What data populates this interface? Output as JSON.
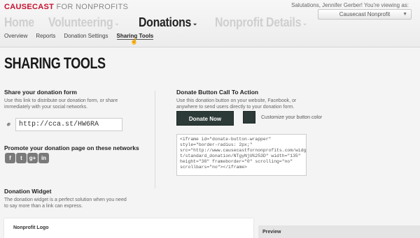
{
  "header": {
    "brand": "CAUSECAST",
    "brand_suffix": " FOR NONPROFITS",
    "greeting": "Salutations, Jennifer Gerber! You're viewing as:",
    "account_select": "Causecast Nonprofit",
    "nav": [
      {
        "label": "Home"
      },
      {
        "label": "Volunteering"
      },
      {
        "label": "Donations"
      },
      {
        "label": "Nonprofit Details"
      }
    ],
    "subnav": [
      "Overview",
      "Reports",
      "Donation Settings",
      "Sharing Tools"
    ]
  },
  "page_title": "SHARING TOOLS",
  "share_form": {
    "heading": "Share your donation form",
    "desc_line1": "Use this link to distribute our donation form, or share",
    "desc_line2": "immediately with your social networks.",
    "url_value": "http://cca.st/HW6RA"
  },
  "promote": {
    "heading": "Promote your donation page on these networks",
    "networks": [
      "f",
      "t",
      "g+",
      "in"
    ]
  },
  "widget": {
    "heading": "Donation Widget",
    "desc_line1": "The donation widget is a perfect solution when you need",
    "desc_line2": "to say more than a link can express.",
    "card_label": "Nonprofit Logo",
    "preview_label": "Preview"
  },
  "cta": {
    "heading": "Donate Button Call To Action",
    "desc_line1": "Use this donation button on your website, Facebook, or",
    "desc_line2": "anywhere to send users directly to your donation form.",
    "button_label": "Donate Now",
    "button_color": "#2d3b38",
    "customize_label": "Customize your button color",
    "embed_code": "<iframe id=\"donate-button-wrapper\"\nstyle=\"border-radius: 2px;\"\nsrc=\"http://www.causecastfornonprofits.com/widge\nt/standard_donation/NTgyNjU%253D\" width=\"135\"\nheight=\"38\" frameborder=\"0\" scrolling=\"no\"\nscrollbars=\"no\"></iframe>"
  }
}
